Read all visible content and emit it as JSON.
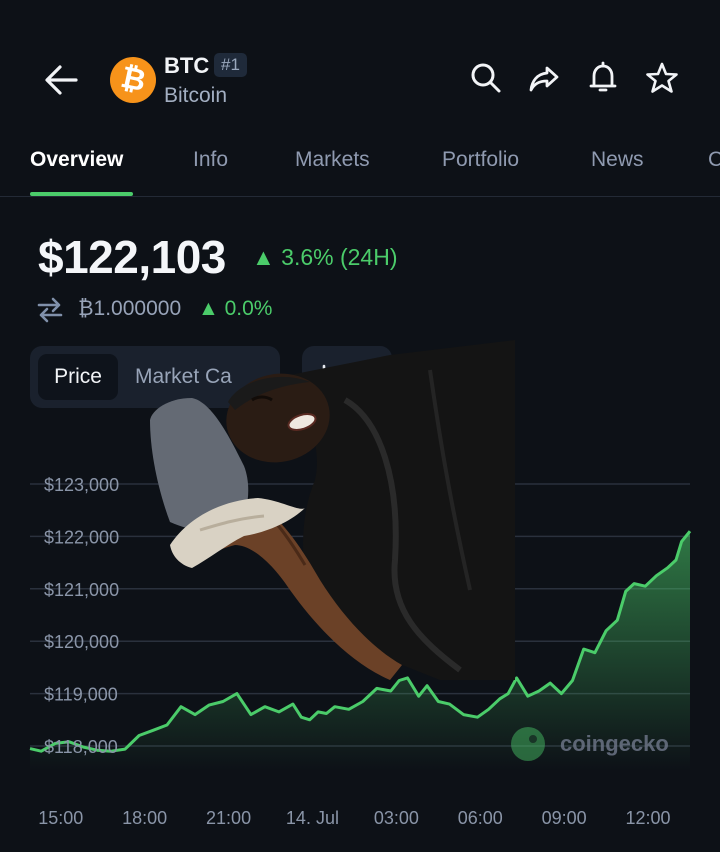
{
  "header": {
    "back_icon": "arrow-left-icon",
    "coin_symbol": "BTC",
    "rank": "#1",
    "coin_name": "Bitcoin",
    "coin_logo_glyph": "₿",
    "coin_logo_color": "#f7931a",
    "actions": [
      "search-icon",
      "share-icon",
      "bell-icon",
      "star-icon"
    ]
  },
  "tabs": [
    {
      "label": "Overview",
      "active": true
    },
    {
      "label": "Info"
    },
    {
      "label": "Markets"
    },
    {
      "label": "Portfolio"
    },
    {
      "label": "News"
    },
    {
      "label": "C"
    }
  ],
  "price": {
    "value": "$122,103",
    "change": "▲ 3.6% (24H)",
    "btc_value": "₿1.000000",
    "btc_change": "▲ 0.0%"
  },
  "chart_controls": {
    "price_label": "Price",
    "market_cap_label": "Market Ca",
    "chart_type_icon": "line-chart-icon"
  },
  "colors": {
    "background": "#0d1117",
    "accent_green": "#4bcc6a",
    "muted_text": "#8f9ab0"
  },
  "chart_data": {
    "type": "area",
    "title": "",
    "xlabel": "",
    "ylabel": "",
    "x_ticks": [
      "15:00",
      "18:00",
      "21:00",
      "14. Jul",
      "03:00",
      "06:00",
      "09:00",
      "12:00"
    ],
    "y_ticks": [
      "$118,000",
      "$119,000",
      "$120,000",
      "$121,000",
      "$122,000",
      "$123,000"
    ],
    "ylim": [
      117600,
      123300
    ],
    "xlim": [
      13.9,
      37.5
    ],
    "grid": true,
    "watermark": "coingecko",
    "series": [
      {
        "color": "#4bcc6a",
        "x": [
          13.9,
          14.3,
          14.8,
          15.3,
          15.8,
          16.3,
          16.8,
          17.3,
          17.8,
          18.3,
          18.8,
          19.3,
          19.8,
          20.3,
          20.8,
          21.3,
          21.8,
          22.3,
          22.8,
          23.3,
          23.6,
          23.9,
          24.2,
          24.5,
          24.8,
          25.3,
          25.8,
          26.3,
          26.8,
          27.1,
          27.4,
          27.8,
          28.1,
          28.5,
          28.9,
          29.4,
          29.9,
          30.3,
          30.7,
          31.0,
          31.3,
          31.7,
          32.1,
          32.5,
          32.9,
          33.3,
          33.7,
          34.1,
          34.5,
          34.9,
          35.2,
          35.5,
          35.9,
          36.3,
          36.7,
          37.0,
          37.2,
          37.5
        ],
        "y": [
          117950,
          117900,
          118050,
          118080,
          117980,
          117920,
          117900,
          117940,
          118200,
          118300,
          118400,
          118750,
          118600,
          118780,
          118850,
          119000,
          118600,
          118750,
          118650,
          118800,
          118550,
          118500,
          118650,
          118620,
          118750,
          118700,
          118850,
          119100,
          119050,
          119250,
          119300,
          118950,
          119150,
          118850,
          118800,
          118600,
          118550,
          118700,
          118900,
          119000,
          119300,
          118950,
          119050,
          119200,
          119000,
          119250,
          119850,
          119780,
          120200,
          120400,
          120950,
          121100,
          121050,
          121250,
          121400,
          121550,
          121900,
          122100
        ]
      }
    ]
  }
}
